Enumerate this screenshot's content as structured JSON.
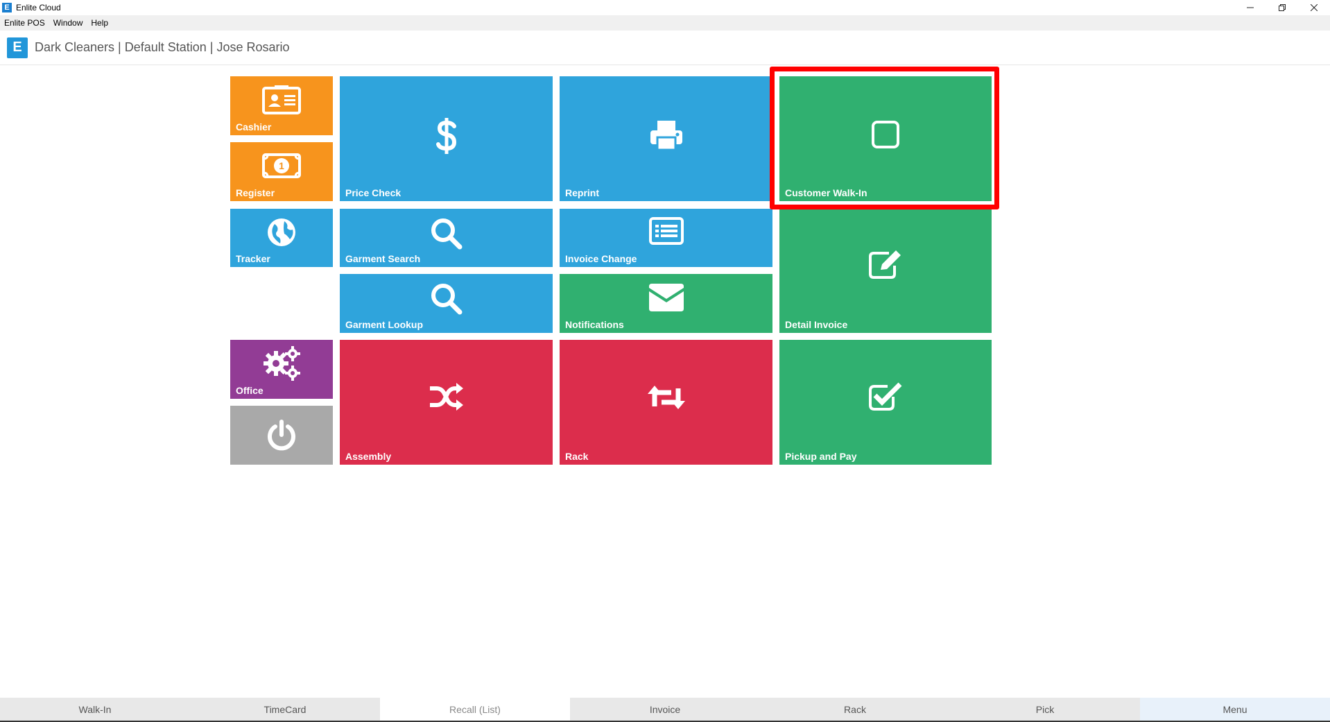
{
  "window": {
    "title": "Enlite Cloud",
    "icon_letter": "E",
    "controls": [
      "minimize-icon",
      "restore-icon",
      "close-icon"
    ]
  },
  "menubar": {
    "items": [
      "Enlite POS",
      "Window",
      "Help"
    ]
  },
  "header": {
    "logo_letter": "E",
    "text": "Dark Cleaners | Default Station | Jose Rosario"
  },
  "tiles": {
    "cashier": {
      "label": "Cashier",
      "icon": "id-card-icon",
      "color": "#f7941d"
    },
    "register": {
      "label": "Register",
      "icon": "money-icon",
      "color": "#f7941d"
    },
    "tracker": {
      "label": "Tracker",
      "icon": "globe-icon",
      "color": "#2fa4dc"
    },
    "office": {
      "label": "Office",
      "icon": "gears-icon",
      "color": "#923c95"
    },
    "power": {
      "label": "",
      "icon": "power-icon",
      "color": "#a9a9a9"
    },
    "price_check": {
      "label": "Price Check",
      "icon": "dollar-icon",
      "color": "#2fa4dc"
    },
    "reprint": {
      "label": "Reprint",
      "icon": "printer-icon",
      "color": "#2fa4dc"
    },
    "customer_walkin": {
      "label": "Customer Walk-In",
      "icon": "square-icon",
      "color": "#30b070"
    },
    "garment_search": {
      "label": "Garment Search",
      "icon": "search-icon",
      "color": "#2fa4dc"
    },
    "invoice_change": {
      "label": "Invoice Change",
      "icon": "list-icon",
      "color": "#2fa4dc"
    },
    "detail_invoice": {
      "label": "Detail Invoice",
      "icon": "edit-icon",
      "color": "#30b070"
    },
    "garment_lookup": {
      "label": "Garment Lookup",
      "icon": "search-icon",
      "color": "#2fa4dc"
    },
    "notifications": {
      "label": "Notifications",
      "icon": "envelope-icon",
      "color": "#30b070"
    },
    "assembly": {
      "label": "Assembly",
      "icon": "shuffle-icon",
      "color": "#dc2d4c"
    },
    "rack": {
      "label": "Rack",
      "icon": "retweet-icon",
      "color": "#dc2d4c"
    },
    "pickup_pay": {
      "label": "Pickup and Pay",
      "icon": "check-square-icon",
      "color": "#30b070"
    }
  },
  "bottom_tabs": [
    "Walk-In",
    "TimeCard",
    "Recall (List)",
    "Invoice",
    "Rack",
    "Pick",
    "Menu"
  ],
  "highlight_color": "#ff0000"
}
